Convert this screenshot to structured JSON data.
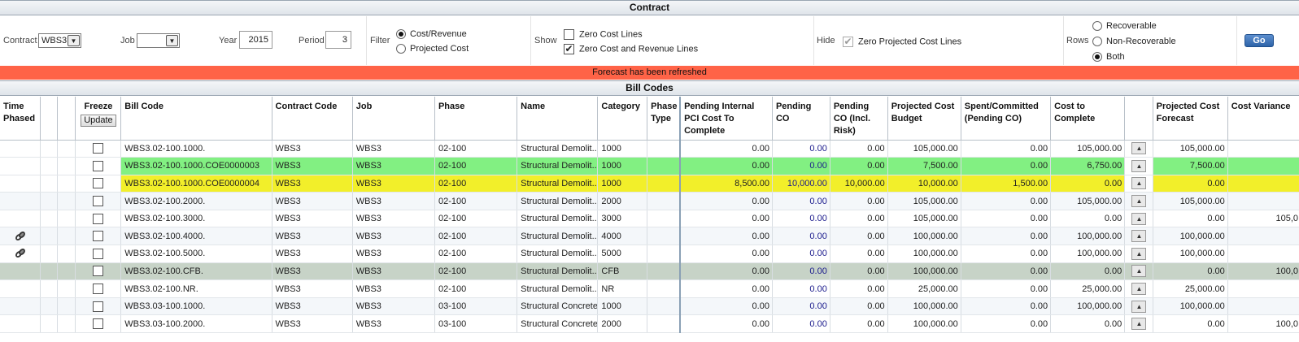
{
  "sections": {
    "contract": "Contract",
    "bill_codes": "Bill Codes"
  },
  "filters": {
    "contract_label": "Contract",
    "contract_value": "WBS3",
    "job_label": "Job",
    "job_value": "",
    "year_label": "Year",
    "year_value": "2015",
    "period_label": "Period",
    "period_value": "3",
    "filter_label": "Filter",
    "filter_options": [
      "Cost/Revenue",
      "Projected Cost"
    ],
    "filter_selected": "Cost/Revenue",
    "show_label": "Show",
    "show_options": [
      {
        "label": "Zero Cost Lines",
        "checked": false
      },
      {
        "label": "Zero Cost and Revenue Lines",
        "checked": true
      }
    ],
    "hide_label": "Hide",
    "hide_option": {
      "label": "Zero Projected Cost Lines",
      "checked": true
    },
    "rows_label": "Rows",
    "rows_options": [
      "Recoverable",
      "Non-Recoverable",
      "Both"
    ],
    "rows_selected": "Both",
    "go_label": "Go"
  },
  "banner": {
    "message": "Forecast has been refreshed",
    "color": "#ff6347"
  },
  "grid": {
    "columns": [
      "Time Phased",
      "",
      "",
      "Freeze",
      "Bill Code",
      "Contract Code",
      "Job",
      "Phase",
      "Name",
      "Category",
      "Phase Type",
      "Pending Internal PCI Cost To Complete",
      "Pending CO",
      "Pending CO (Incl. Risk)",
      "Projected Cost Budget",
      "Spent/Committed (Pending CO)",
      "Cost to Complete",
      "",
      "Projected Cost Forecast",
      "Cost Variance"
    ],
    "update_label": "Update",
    "rows": [
      {
        "linked": false,
        "bill_code": "WBS3.02-100.1000.",
        "contract_code": "WBS3",
        "job": "WBS3",
        "phase": "02-100",
        "name": "Structural Demolit...",
        "category": "1000",
        "pci": "0.00",
        "pending_co": "0.00",
        "pending_co_risk": "0.00",
        "budget": "105,000.00",
        "spent": "0.00",
        "ctc": "105,000.00",
        "forecast": "105,000.00",
        "variance": "",
        "highlight": "none"
      },
      {
        "linked": false,
        "bill_code": "WBS3.02-100.1000.COE0000003",
        "contract_code": "WBS3",
        "job": "WBS3",
        "phase": "02-100",
        "name": "Structural Demolit...",
        "category": "1000",
        "pci": "0.00",
        "pending_co": "0.00",
        "pending_co_risk": "0.00",
        "budget": "7,500.00",
        "spent": "0.00",
        "ctc": "6,750.00",
        "forecast": "7,500.00",
        "variance": "",
        "highlight": "green"
      },
      {
        "linked": false,
        "bill_code": "WBS3.02-100.1000.COE0000004",
        "contract_code": "WBS3",
        "job": "WBS3",
        "phase": "02-100",
        "name": "Structural Demolit...",
        "category": "1000",
        "pci": "8,500.00",
        "pending_co": "10,000.00",
        "pending_co_risk": "10,000.00",
        "budget": "10,000.00",
        "spent": "1,500.00",
        "ctc": "0.00",
        "forecast": "0.00",
        "variance": "",
        "highlight": "yellow"
      },
      {
        "linked": false,
        "bill_code": "WBS3.02-100.2000.",
        "contract_code": "WBS3",
        "job": "WBS3",
        "phase": "02-100",
        "name": "Structural Demolit...",
        "category": "2000",
        "pci": "0.00",
        "pending_co": "0.00",
        "pending_co_risk": "0.00",
        "budget": "105,000.00",
        "spent": "0.00",
        "ctc": "105,000.00",
        "forecast": "105,000.00",
        "variance": "",
        "highlight": "none"
      },
      {
        "linked": false,
        "bill_code": "WBS3.02-100.3000.",
        "contract_code": "WBS3",
        "job": "WBS3",
        "phase": "02-100",
        "name": "Structural Demolit...",
        "category": "3000",
        "pci": "0.00",
        "pending_co": "0.00",
        "pending_co_risk": "0.00",
        "budget": "105,000.00",
        "spent": "0.00",
        "ctc": "0.00",
        "forecast": "0.00",
        "variance": "105,0",
        "highlight": "none"
      },
      {
        "linked": true,
        "bill_code": "WBS3.02-100.4000.",
        "contract_code": "WBS3",
        "job": "WBS3",
        "phase": "02-100",
        "name": "Structural Demolit...",
        "category": "4000",
        "pci": "0.00",
        "pending_co": "0.00",
        "pending_co_risk": "0.00",
        "budget": "100,000.00",
        "spent": "0.00",
        "ctc": "100,000.00",
        "forecast": "100,000.00",
        "variance": "",
        "highlight": "none"
      },
      {
        "linked": true,
        "bill_code": "WBS3.02-100.5000.",
        "contract_code": "WBS3",
        "job": "WBS3",
        "phase": "02-100",
        "name": "Structural Demolit...",
        "category": "5000",
        "pci": "0.00",
        "pending_co": "0.00",
        "pending_co_risk": "0.00",
        "budget": "100,000.00",
        "spent": "0.00",
        "ctc": "100,000.00",
        "forecast": "100,000.00",
        "variance": "",
        "highlight": "none"
      },
      {
        "linked": false,
        "bill_code": "WBS3.02-100.CFB.",
        "contract_code": "WBS3",
        "job": "WBS3",
        "phase": "02-100",
        "name": "Structural Demolit...",
        "category": "CFB",
        "pci": "0.00",
        "pending_co": "0.00",
        "pending_co_risk": "0.00",
        "budget": "100,000.00",
        "spent": "0.00",
        "ctc": "0.00",
        "forecast": "0.00",
        "variance": "100,0",
        "highlight": "gray"
      },
      {
        "linked": false,
        "bill_code": "WBS3.02-100.NR.",
        "contract_code": "WBS3",
        "job": "WBS3",
        "phase": "02-100",
        "name": "Structural Demolit...",
        "category": "NR",
        "pci": "0.00",
        "pending_co": "0.00",
        "pending_co_risk": "0.00",
        "budget": "25,000.00",
        "spent": "0.00",
        "ctc": "25,000.00",
        "forecast": "25,000.00",
        "variance": "",
        "highlight": "none"
      },
      {
        "linked": false,
        "bill_code": "WBS3.03-100.1000.",
        "contract_code": "WBS3",
        "job": "WBS3",
        "phase": "03-100",
        "name": "Structural Concrete",
        "category": "1000",
        "pci": "0.00",
        "pending_co": "0.00",
        "pending_co_risk": "0.00",
        "budget": "100,000.00",
        "spent": "0.00",
        "ctc": "100,000.00",
        "forecast": "100,000.00",
        "variance": "",
        "highlight": "none"
      },
      {
        "linked": false,
        "bill_code": "WBS3.03-100.2000.",
        "contract_code": "WBS3",
        "job": "WBS3",
        "phase": "03-100",
        "name": "Structural Concrete",
        "category": "2000",
        "pci": "0.00",
        "pending_co": "0.00",
        "pending_co_risk": "0.00",
        "budget": "100,000.00",
        "spent": "0.00",
        "ctc": "0.00",
        "forecast": "0.00",
        "variance": "100,0",
        "highlight": "none"
      }
    ]
  },
  "colors": {
    "green_row": "#82f082",
    "yellow_row": "#f2ef2a",
    "gray_row": "#c7d3c7",
    "banner": "#ff6347",
    "go_button": "#2d63a8"
  },
  "icons": {
    "sort_up": "up-arrow-icon",
    "linked": "chain-link-icon"
  }
}
